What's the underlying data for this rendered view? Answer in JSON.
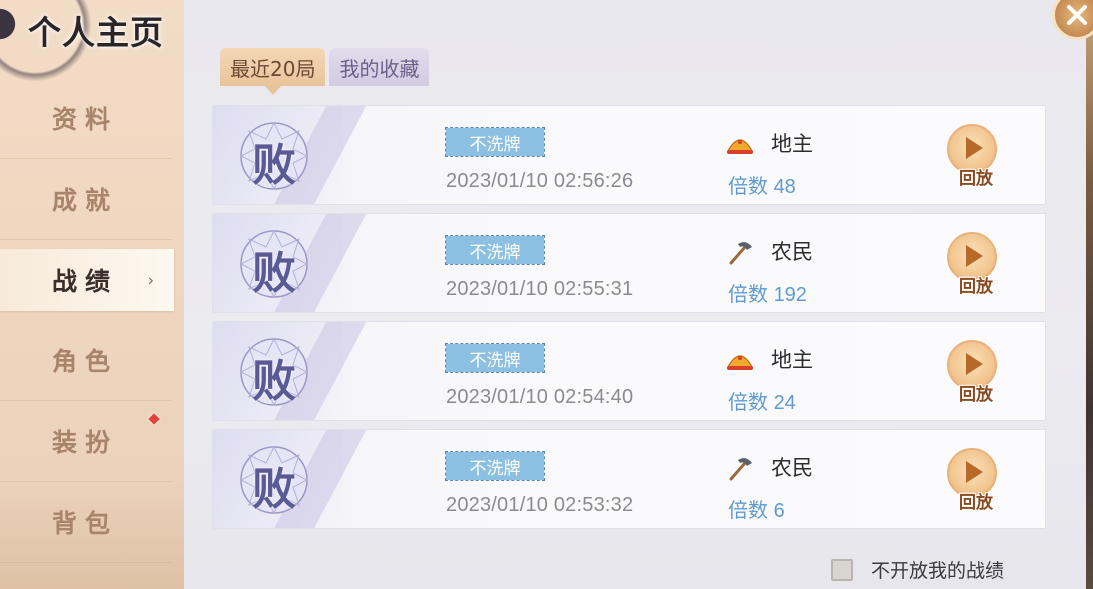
{
  "header": {
    "title": "个人主页"
  },
  "sidebar": {
    "items": [
      {
        "label": "资料",
        "active": false
      },
      {
        "label": "成就",
        "active": false
      },
      {
        "label": "战绩",
        "active": true
      },
      {
        "label": "角色",
        "active": false
      },
      {
        "label": "装扮",
        "active": false,
        "badge": "red-dot"
      },
      {
        "label": "背包",
        "active": false
      }
    ]
  },
  "tabs": [
    {
      "label": "最近20局",
      "active": true
    },
    {
      "label": "我的收藏",
      "active": false
    }
  ],
  "records": [
    {
      "result": "败",
      "tag": "不洗牌",
      "time": "2023/01/10 02:56:26",
      "role": "地主",
      "role_icon": "landlord-hat-icon",
      "multiplier_label": "倍数",
      "multiplier": "48",
      "replay_label": "回放"
    },
    {
      "result": "败",
      "tag": "不洗牌",
      "time": "2023/01/10 02:55:31",
      "role": "农民",
      "role_icon": "farmer-hoe-icon",
      "multiplier_label": "倍数",
      "multiplier": "192",
      "replay_label": "回放"
    },
    {
      "result": "败",
      "tag": "不洗牌",
      "time": "2023/01/10 02:54:40",
      "role": "地主",
      "role_icon": "landlord-hat-icon",
      "multiplier_label": "倍数",
      "multiplier": "24",
      "replay_label": "回放"
    },
    {
      "result": "败",
      "tag": "不洗牌",
      "time": "2023/01/10 02:53:32",
      "role": "农民",
      "role_icon": "farmer-hoe-icon",
      "multiplier_label": "倍数",
      "multiplier": "6",
      "replay_label": "回放"
    }
  ],
  "privacy": {
    "label": "不开放我的战绩",
    "checked": false
  },
  "colors": {
    "accent_gold": "#e9c49b",
    "multiplier_blue": "#5f9bd0",
    "tag_blue": "#8cc0e2",
    "loss_purple": "#5a5a96"
  }
}
